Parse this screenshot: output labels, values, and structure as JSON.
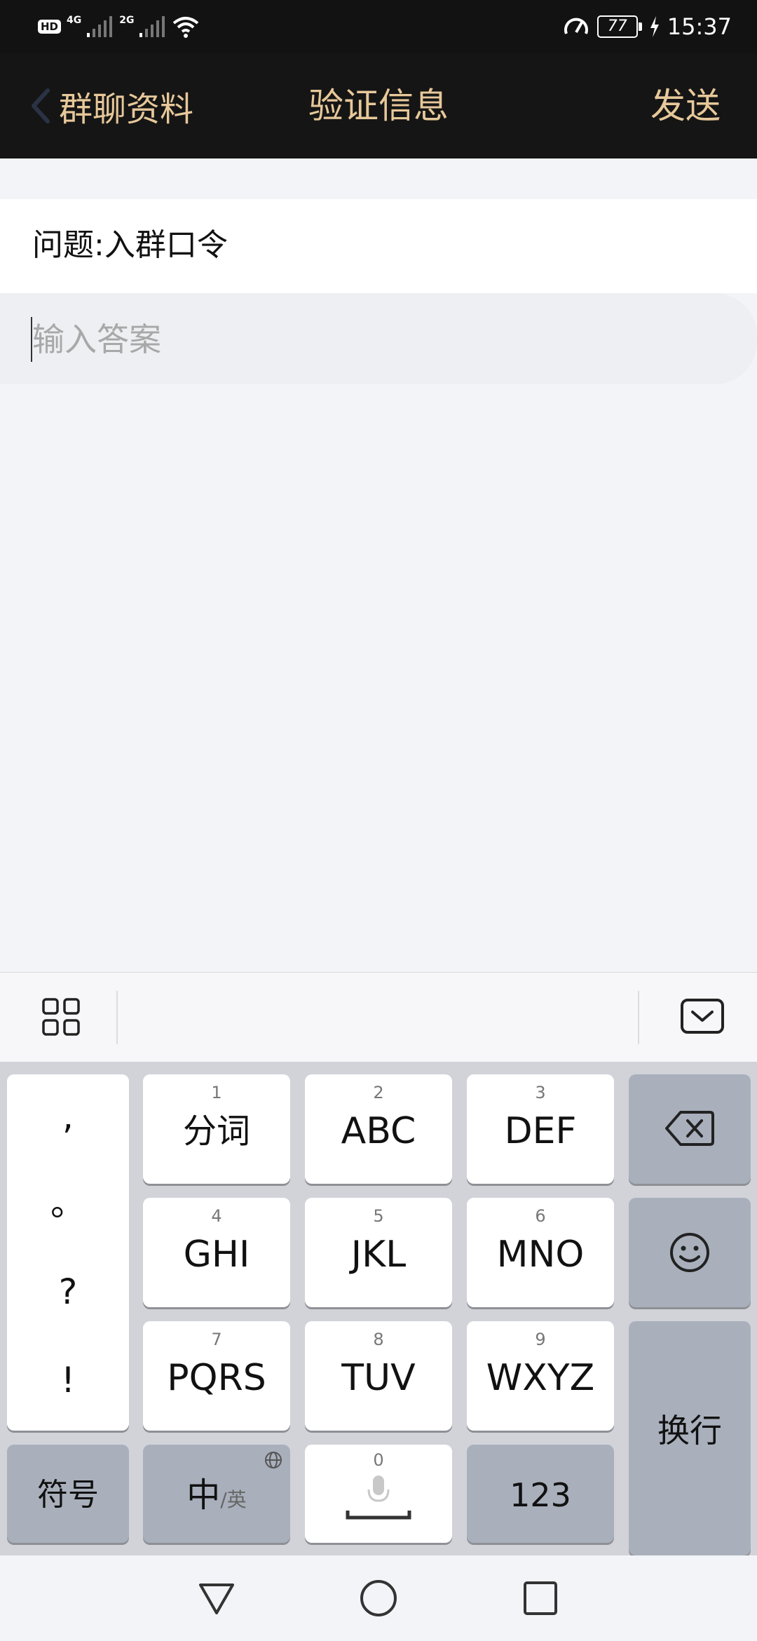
{
  "status_bar": {
    "hd": "HD",
    "net1": "4G",
    "net2": "2G",
    "battery": "77",
    "time": "15:37"
  },
  "header": {
    "back_label": "群聊资料",
    "title": "验证信息",
    "send_label": "发送",
    "accent_color": "#e7c89a"
  },
  "question": {
    "text": "问题:入群口令"
  },
  "answer": {
    "placeholder": "输入答案",
    "value": ""
  },
  "keyboard": {
    "punctuation": [
      ",",
      "。",
      "?",
      "!"
    ],
    "keys": [
      {
        "num": "1",
        "label": "分词"
      },
      {
        "num": "2",
        "label": "ABC"
      },
      {
        "num": "3",
        "label": "DEF"
      },
      {
        "num": "4",
        "label": "GHI"
      },
      {
        "num": "5",
        "label": "JKL"
      },
      {
        "num": "6",
        "label": "MNO"
      },
      {
        "num": "7",
        "label": "PQRS"
      },
      {
        "num": "8",
        "label": "TUV"
      },
      {
        "num": "9",
        "label": "WXYZ"
      }
    ],
    "symbols_label": "符号",
    "lang_main": "中",
    "lang_alt": "/英",
    "space_num": "0",
    "numbers_label": "123",
    "enter_label": "换行",
    "icons": {
      "delete": "backspace-icon",
      "emoji": "emoji-icon",
      "globe": "globe-icon",
      "mic": "microphone-icon",
      "grid": "grid-icon",
      "hide": "keyboard-hide-icon"
    }
  },
  "nav_bar": {
    "icons": [
      "back-triangle-icon",
      "home-circle-icon",
      "recents-square-icon"
    ]
  }
}
